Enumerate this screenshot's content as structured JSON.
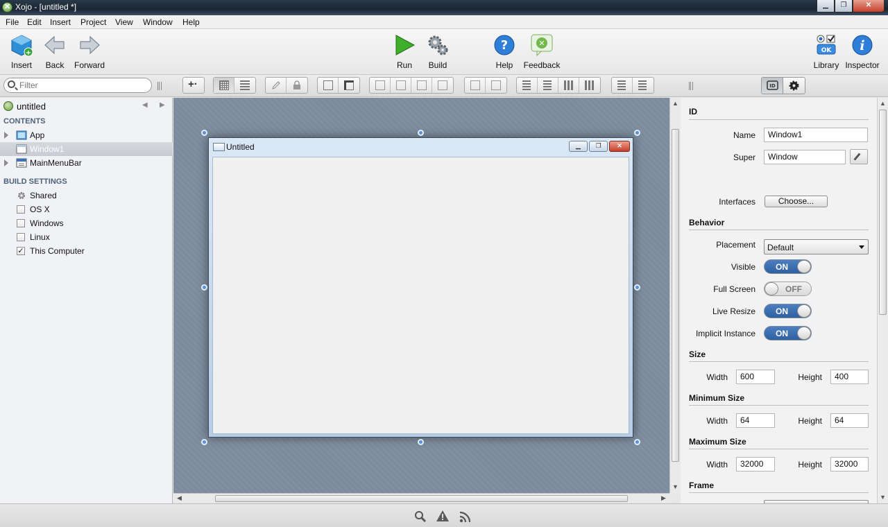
{
  "window": {
    "title": "Xojo - [untitled *]",
    "controls": {
      "minimize": "▁",
      "maximize": "❐",
      "close": "✕"
    }
  },
  "menu": [
    "File",
    "Edit",
    "Insert",
    "Project",
    "View",
    "Window",
    "Help"
  ],
  "toolbar": {
    "insert": "Insert",
    "back": "Back",
    "forward": "Forward",
    "run": "Run",
    "build": "Build",
    "help": "Help",
    "feedback": "Feedback",
    "library": "Library",
    "inspector": "Inspector"
  },
  "filter": {
    "placeholder": "Filter"
  },
  "navigator": {
    "project_name": "untitled",
    "contents_header": "CONTENTS",
    "contents": [
      {
        "label": "App",
        "icon": "app-icon",
        "expandable": true,
        "selected": false
      },
      {
        "label": "Window1",
        "icon": "window-icon",
        "expandable": false,
        "selected": true
      },
      {
        "label": "MainMenuBar",
        "icon": "menubar-icon",
        "expandable": true,
        "selected": false
      }
    ],
    "build_header": "BUILD SETTINGS",
    "build_settings": [
      {
        "label": "Shared",
        "kind": "gear",
        "checked": null
      },
      {
        "label": "OS X",
        "kind": "checkbox",
        "checked": false
      },
      {
        "label": "Windows",
        "kind": "checkbox",
        "checked": false
      },
      {
        "label": "Linux",
        "kind": "checkbox",
        "checked": false
      },
      {
        "label": "This Computer",
        "kind": "checkbox",
        "checked": true
      }
    ]
  },
  "design_window": {
    "title": "Untitled"
  },
  "inspector": {
    "id_header": "ID",
    "name_label": "Name",
    "name_value": "Window1",
    "super_label": "Super",
    "super_value": "Window",
    "interfaces_label": "Interfaces",
    "interfaces_button": "Choose...",
    "behavior_header": "Behavior",
    "placement_label": "Placement",
    "placement_value": "Default",
    "toggles": [
      {
        "label": "Visible",
        "state": "ON"
      },
      {
        "label": "Full Screen",
        "state": "OFF"
      },
      {
        "label": "Live Resize",
        "state": "ON"
      },
      {
        "label": "Implicit Instance",
        "state": "ON"
      }
    ],
    "size_header": "Size",
    "size": {
      "width_label": "Width",
      "width": "600",
      "height_label": "Height",
      "height": "400"
    },
    "min_header": "Minimum Size",
    "min": {
      "width_label": "Width",
      "width": "64",
      "height_label": "Height",
      "height": "64"
    },
    "max_header": "Maximum Size",
    "max": {
      "width_label": "Width",
      "width": "32000",
      "height_label": "Height",
      "height": "32000"
    },
    "frame_header": "Frame"
  },
  "colors": {
    "canvas": "#7d8c9d",
    "toggle_on": "#3b6bb0",
    "accent": "#5b8fd8"
  }
}
